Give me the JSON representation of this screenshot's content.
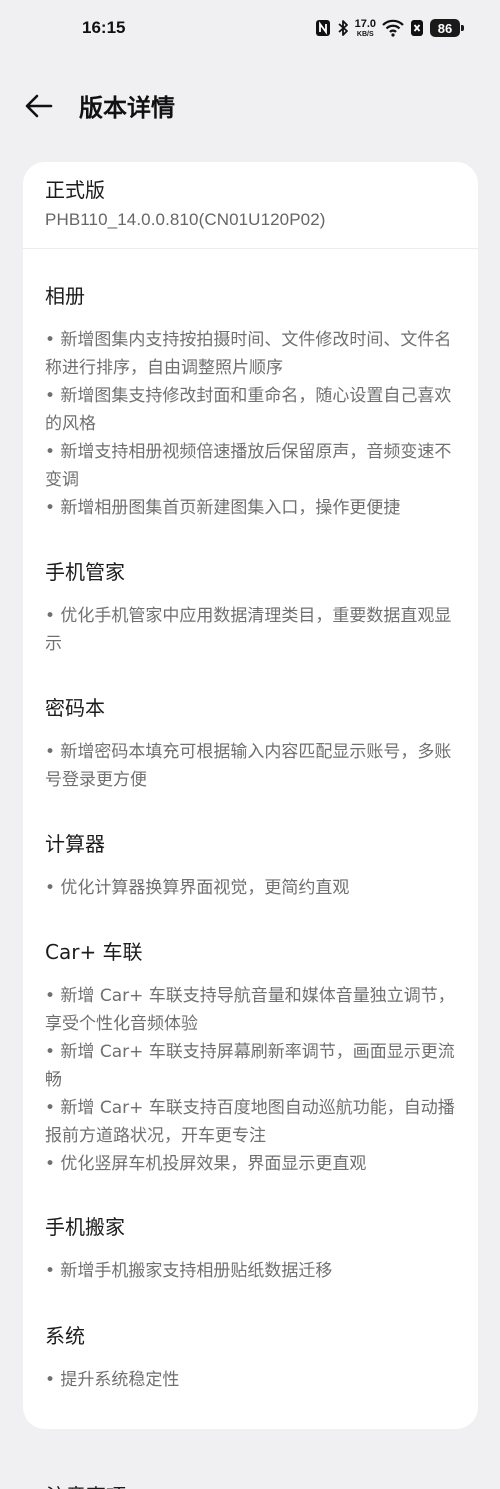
{
  "status_bar": {
    "time": "16:15",
    "speed_value": "17.0",
    "speed_unit": "KB/S",
    "battery": "86",
    "icons": [
      "nfc-icon",
      "bluetooth-icon",
      "wifi-icon",
      "sim-icon",
      "battery-icon"
    ]
  },
  "header": {
    "title": "版本详情",
    "back_icon": "arrow-left-icon"
  },
  "version": {
    "label": "正式版",
    "number": "PHB110_14.0.0.810(CN01U120P02)"
  },
  "sections": [
    {
      "title": "相册",
      "items": [
        "• 新增图集内支持按拍摄时间、文件修改时间、文件名称进行排序，自由调整照片顺序",
        "• 新增图集支持修改封面和重命名，随心设置自己喜欢的风格",
        "• 新增支持相册视频倍速播放后保留原声，音频变速不变调",
        "• 新增相册图集首页新建图集入口，操作更便捷"
      ]
    },
    {
      "title": "手机管家",
      "items": [
        "• 优化手机管家中应用数据清理类目，重要数据直观显示"
      ]
    },
    {
      "title": "密码本",
      "items": [
        "• 新增密码本填充可根据输入内容匹配显示账号，多账号登录更方便"
      ]
    },
    {
      "title": "计算器",
      "items": [
        "• 优化计算器换算界面视觉，更简约直观"
      ]
    },
    {
      "title": "Car+ 车联",
      "items": [
        "• 新增 Car+ 车联支持导航音量和媒体音量独立调节，享受个性化音频体验",
        "• 新增 Car+ 车联支持屏幕刷新率调节，画面显示更流畅",
        "• 新增 Car+ 车联支持百度地图自动巡航功能，自动播报前方道路状况，开车更专注",
        "• 优化竖屏车机投屏效果，界面显示更直观"
      ]
    },
    {
      "title": "手机搬家",
      "items": [
        "• 新增手机搬家支持相册贴纸数据迁移"
      ]
    },
    {
      "title": "系统",
      "items": [
        "• 提升系统稳定性"
      ]
    }
  ],
  "bottom_partial_title": "注意事项"
}
